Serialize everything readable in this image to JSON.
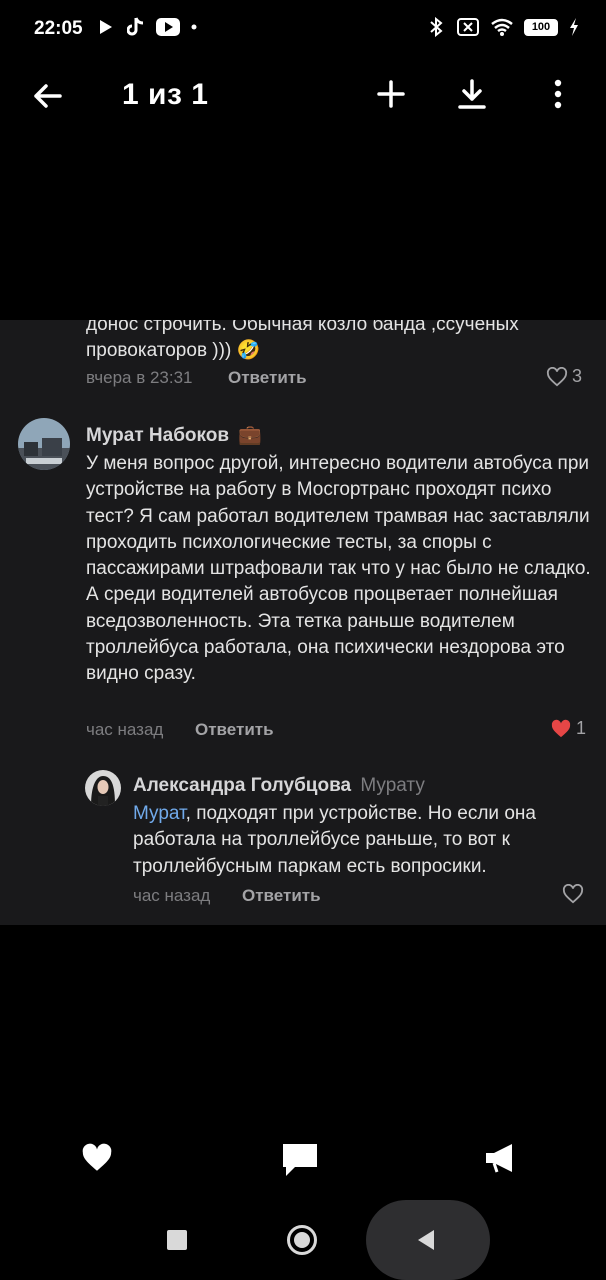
{
  "status_bar": {
    "time": "22:05",
    "left_icons": [
      "play-icon",
      "tiktok-icon",
      "youtube-icon",
      "dot-icon"
    ],
    "right_icons": [
      "bluetooth-icon",
      "sim-icon",
      "wifi-icon",
      "battery-icon",
      "charging-icon"
    ],
    "battery": "100"
  },
  "top_bar": {
    "counter": "1 из 1",
    "icons": [
      "back-arrow-icon",
      "plus-icon",
      "download-icon",
      "more-vertical-icon"
    ]
  },
  "comments": {
    "previous": {
      "text_line1": "донос строчить. Обычная козло банда ,ссученых",
      "text_line2": "провокаторов ))) 🤣",
      "time": "вчера в 23:31",
      "reply_label": "Ответить",
      "likes": "3"
    },
    "main": {
      "author": "Мурат Набоков",
      "badge": "💼",
      "text": "У меня вопрос другой, интересно водители автобуса при устройстве на работу в Мосгортранс проходят психо тест? Я сам работал водителем трамвая нас заставляли проходить психологические тесты, за споры с пассажирами штрафовали так что у нас было не сладко. А среди водителей автобусов процветает полнейшая вседозволенность. Эта тетка раньше водителем троллейбуса работала, она психически нездорова это видно сразу.",
      "time": "час назад",
      "reply_label": "Ответить",
      "likes": "1",
      "liked_color": "#e64646"
    },
    "reply": {
      "author": "Александра Голубцова",
      "reply_to": "Мурату",
      "mention": "Мурат",
      "text": ", подходят при устройстве. Но если она работала на троллейбусе раньше, то вот к троллейбусным паркам есть вопросики.",
      "time": "час назад",
      "reply_label": "Ответить"
    }
  },
  "bottom_actions": [
    "heart-icon",
    "comment-icon",
    "share-icon"
  ],
  "nav_bar": [
    "recent-apps-icon",
    "home-icon",
    "back-icon"
  ],
  "colors": {
    "panel_bg": "#19191b",
    "mention": "#71aaeb",
    "liked": "#e64646"
  }
}
